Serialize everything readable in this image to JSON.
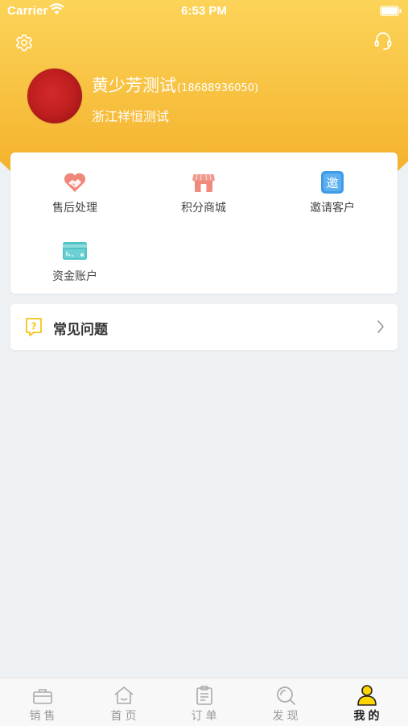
{
  "status_bar": {
    "carrier": "Carrier",
    "time": "6:53 PM"
  },
  "header": {
    "gradient_top": "#fbd34e",
    "gradient_bottom": "#f5b430",
    "settings_icon": "gear-icon",
    "service_icon": "headset-icon"
  },
  "profile": {
    "name": "黄少芳测试",
    "phone": "(18688936050)",
    "company": "浙江祥恒测试",
    "avatar_color": "#c01f1f"
  },
  "menu": {
    "items": [
      {
        "label": "售后处理",
        "icon": "handshake-heart-icon"
      },
      {
        "label": "积分商城",
        "icon": "shop-icon"
      },
      {
        "label": "邀请客户",
        "icon": "invite-icon",
        "icon_text": "邀"
      },
      {
        "label": "资金账户",
        "icon": "card-icon"
      }
    ]
  },
  "faq": {
    "label": "常见问题",
    "icon": "question-icon"
  },
  "tabbar": {
    "active_color": "#ffd500",
    "tabs": [
      {
        "label": "销售",
        "icon": "briefcase-icon"
      },
      {
        "label": "首页",
        "icon": "home-icon"
      },
      {
        "label": "订单",
        "icon": "clipboard-icon"
      },
      {
        "label": "发现",
        "icon": "search-icon"
      },
      {
        "label": "我的",
        "icon": "person-icon",
        "active": true
      }
    ]
  }
}
